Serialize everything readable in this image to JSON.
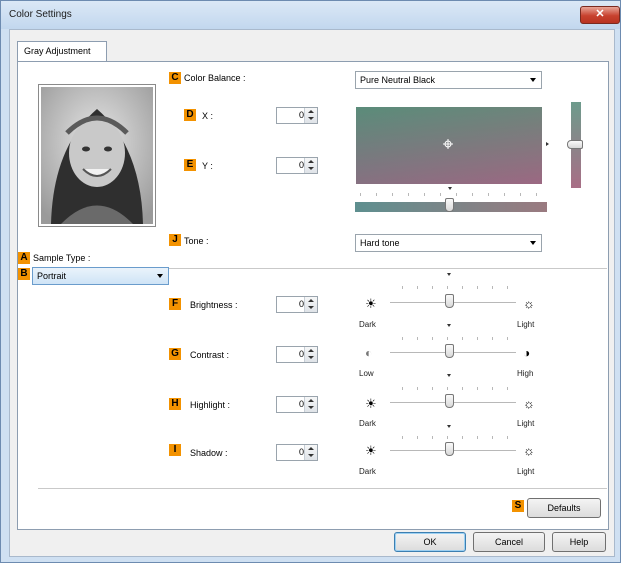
{
  "window": {
    "title": "Color Settings",
    "close_glyph": "✕"
  },
  "tab": {
    "label": "Gray Adjustment"
  },
  "preview": {
    "description_icon": "photo-portrait"
  },
  "badges": {
    "A": "A",
    "B": "B",
    "C": "C",
    "D": "D",
    "E": "E",
    "F": "F",
    "G": "G",
    "H": "H",
    "I": "I",
    "J": "J",
    "S": "S"
  },
  "color_balance": {
    "label": "Color Balance :",
    "selected": "Pure Neutral Black"
  },
  "x": {
    "label": "X :",
    "value": "0"
  },
  "y": {
    "label": "Y :",
    "value": "0"
  },
  "tone": {
    "label": "Tone :",
    "selected": "Hard tone"
  },
  "sample_type": {
    "label": "Sample Type :",
    "selected": "Portrait"
  },
  "brightness": {
    "label": "Brightness :",
    "value": "0",
    "low": "Dark",
    "high": "Light",
    "level": 0.5
  },
  "contrast": {
    "label": "Contrast :",
    "value": "0",
    "low": "Low",
    "high": "High",
    "level": 0.5
  },
  "highlight": {
    "label": "Highlight :",
    "value": "0",
    "low": "Dark",
    "high": "Light",
    "level": 0.5
  },
  "shadow": {
    "label": "Shadow :",
    "value": "0",
    "low": "Dark",
    "high": "Light",
    "level": 0.5
  },
  "buttons": {
    "defaults": "Defaults",
    "ok": "OK",
    "cancel": "Cancel",
    "help": "Help"
  },
  "colors": {
    "badge": "#f39200",
    "close": "#c8412e",
    "title_bg": "#cfe0f2"
  }
}
